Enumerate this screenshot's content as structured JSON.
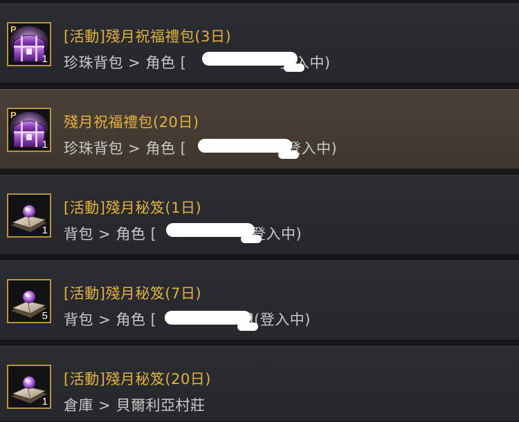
{
  "items": [
    {
      "title": "[活動]殘月祝福禮包(3日)",
      "location": "珍珠背包 > 角色 [",
      "status": "登入中)",
      "quantity": "1",
      "icon": "purple-treasure-chest-icon",
      "pearl_badge": "P",
      "selected": false
    },
    {
      "title": "殘月祝福禮包(20日)",
      "location": "珍珠背包 > 角色 [",
      "status": "(登入中)",
      "quantity": "1",
      "icon": "purple-treasure-chest-icon",
      "pearl_badge": "P",
      "selected": true
    },
    {
      "title": "[活動]殘月秘笈(1日)",
      "location": "背包 > 角色 [",
      "status": "(登入中)",
      "quantity": "1",
      "icon": "secret-book-icon",
      "selected": false
    },
    {
      "title": "[活動]殘月秘笈(7日)",
      "location": "背包 > 角色 [",
      "status": "](登入中)",
      "quantity": "5",
      "icon": "secret-book-icon",
      "selected": false
    },
    {
      "title": "[活動]殘月秘笈(20日)",
      "location": "倉庫 > 貝爾利亞村莊",
      "quantity": "1",
      "icon": "secret-book-icon",
      "selected": false
    }
  ],
  "colors": {
    "title": "#e3b13f",
    "location": "#c9c9c9",
    "row_bg": "#2a2b30",
    "selected_row_bg": "#453c33",
    "icon_border": "#b6953c"
  }
}
